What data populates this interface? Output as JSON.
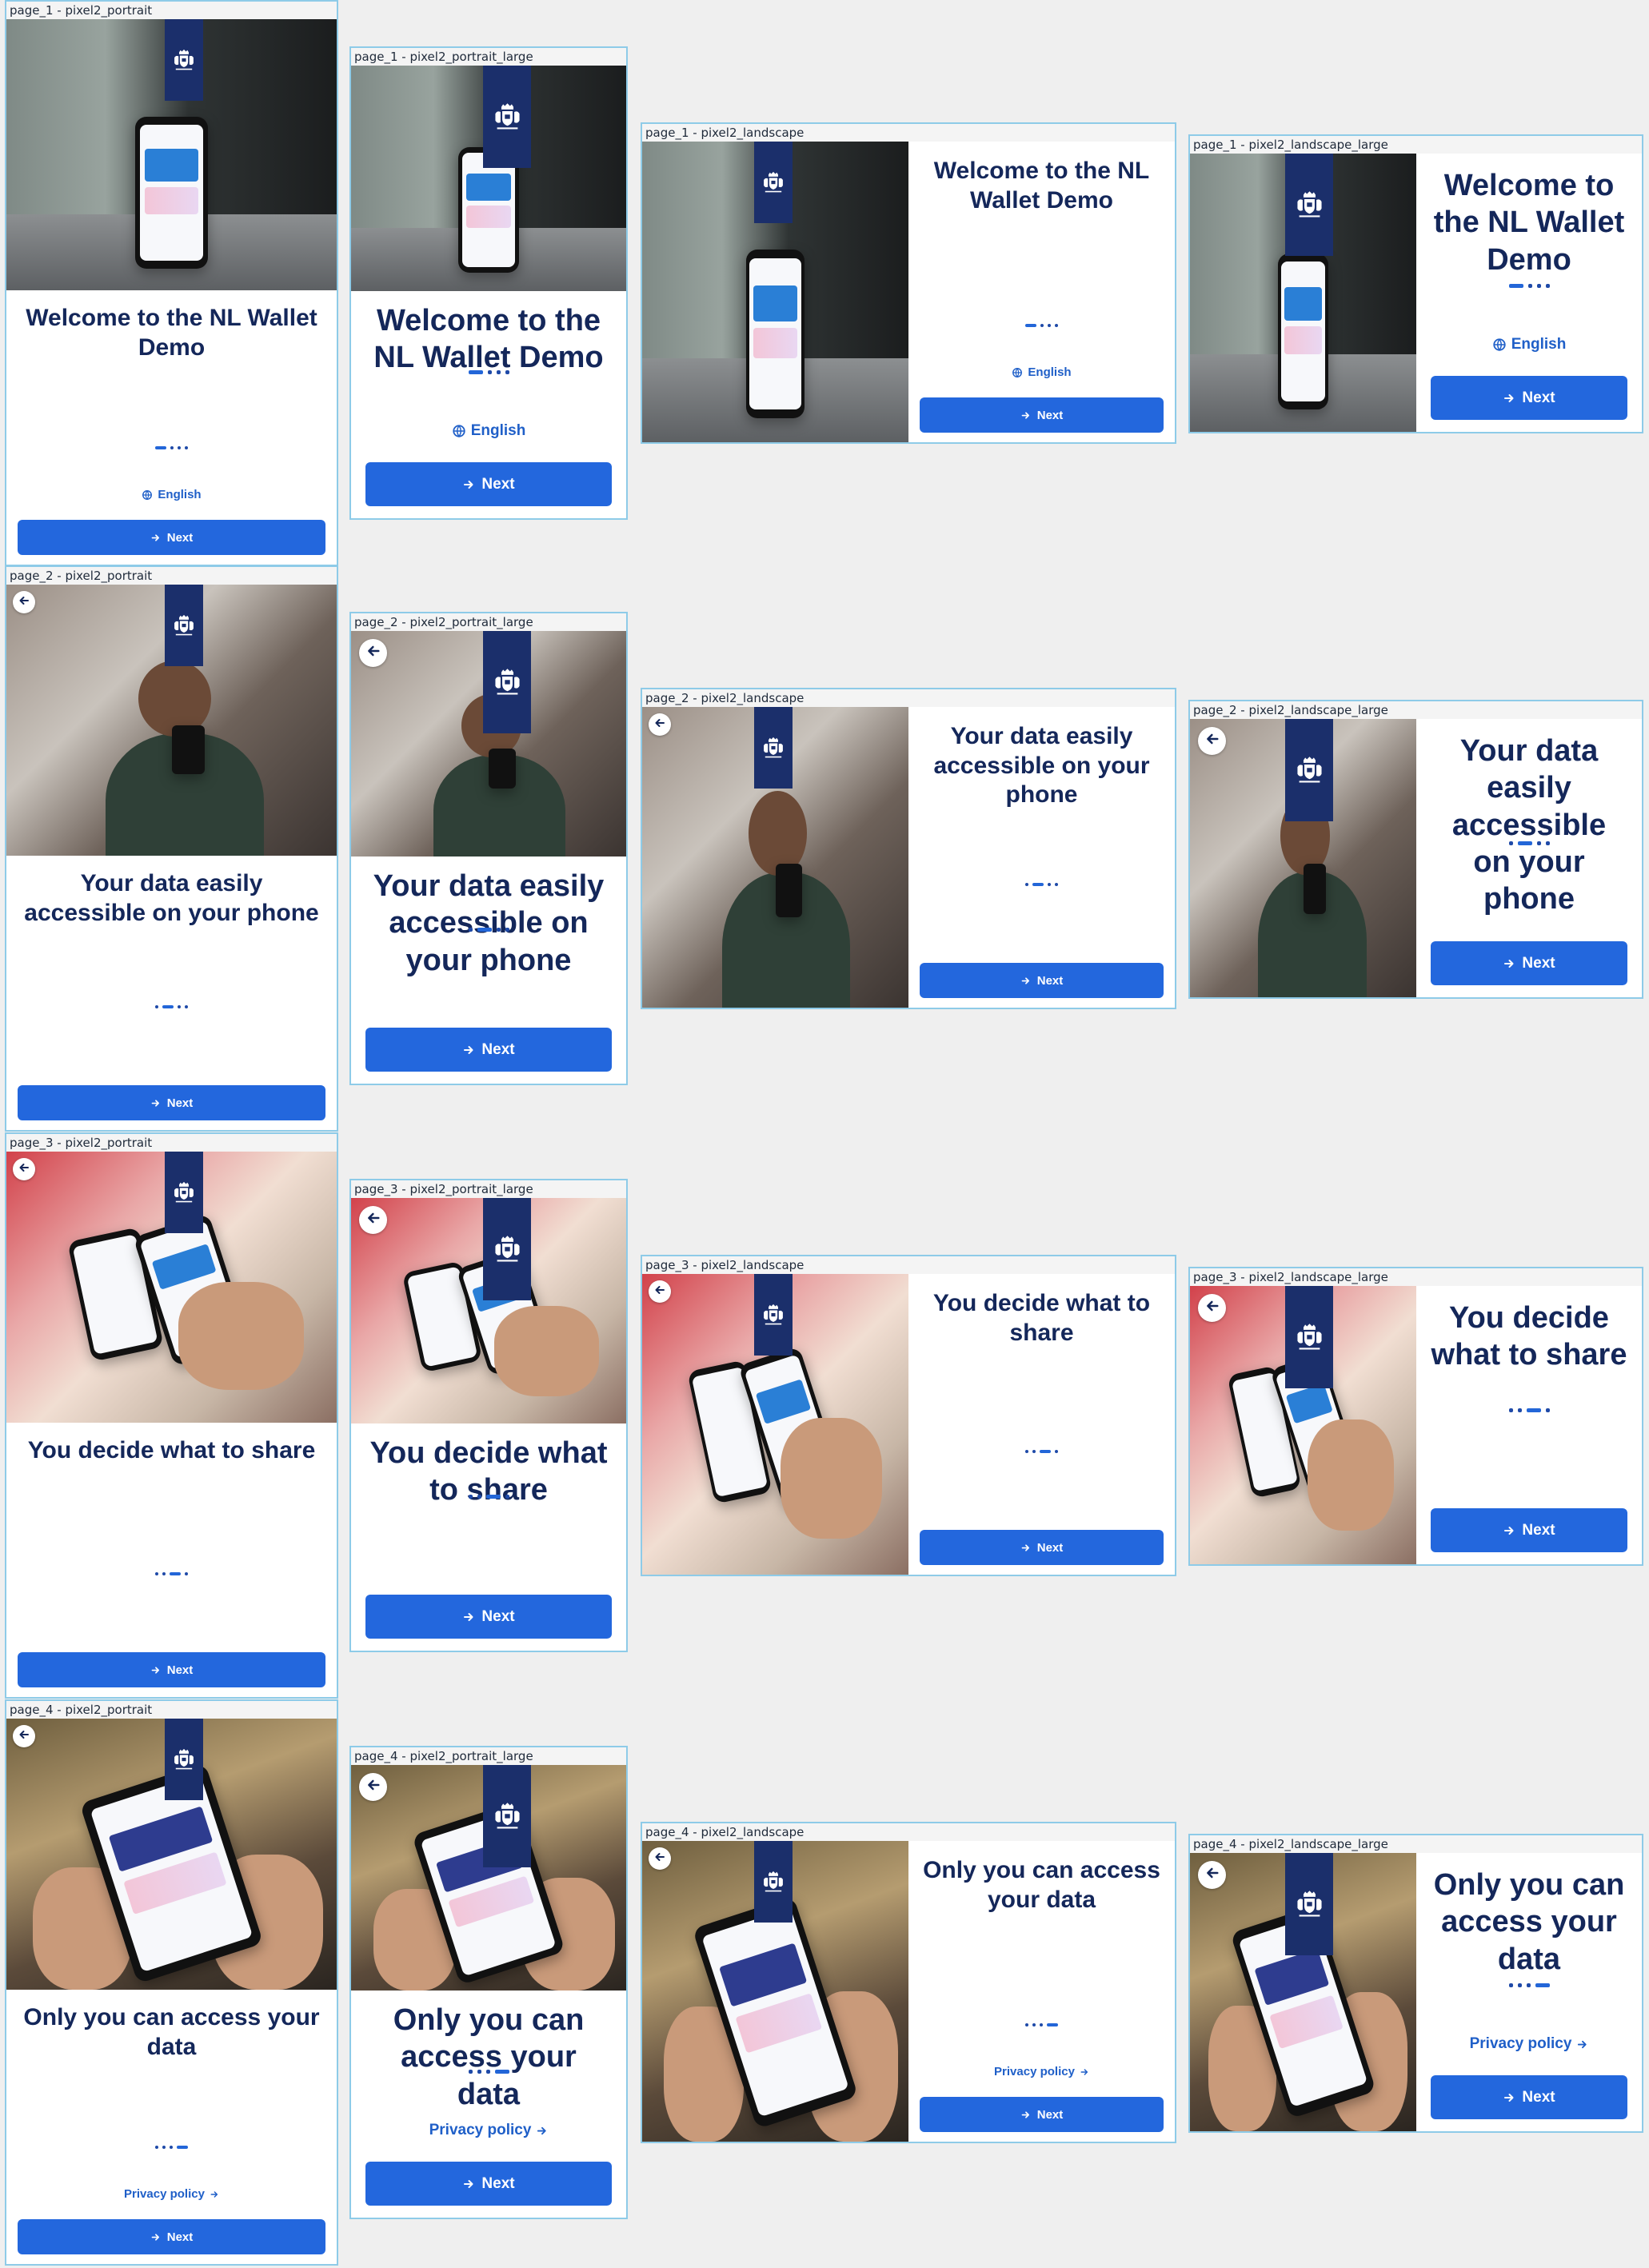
{
  "colors": {
    "accent": "#2367dd",
    "title": "#14275a",
    "banner": "#1b2f6b",
    "frame_border": "#8ecbe8",
    "canvas": "#efefef"
  },
  "pages": [
    {
      "title": "Welcome to the NL Wallet Demo",
      "active_dot": 0,
      "link_label": "English",
      "link_icon": "globe-icon",
      "next_label": "Next",
      "has_back": false,
      "frames": {
        "portrait": "page_1 - pixel2_portrait",
        "portrait_large": "page_1 - pixel2_portrait_large",
        "landscape": "page_1 - pixel2_landscape",
        "landscape_large": "page_1 - pixel2_landscape_large"
      }
    },
    {
      "title": "Your data easily accessible on your phone",
      "active_dot": 1,
      "link_label": "",
      "link_icon": "",
      "next_label": "Next",
      "has_back": true,
      "frames": {
        "portrait": "page_2 - pixel2_portrait",
        "portrait_large": "page_2 - pixel2_portrait_large",
        "landscape": "page_2 - pixel2_landscape",
        "landscape_large": "page_2 - pixel2_landscape_large"
      }
    },
    {
      "title": "You decide what to share",
      "active_dot": 2,
      "link_label": "",
      "link_icon": "",
      "next_label": "Next",
      "has_back": true,
      "frames": {
        "portrait": "page_3 - pixel2_portrait",
        "portrait_large": "page_3 - pixel2_portrait_large",
        "landscape": "page_3 - pixel2_landscape",
        "landscape_large": "page_3 - pixel2_landscape_large"
      }
    },
    {
      "title": "Only you can access your data",
      "active_dot": 3,
      "link_label": "Privacy policy",
      "link_icon": "arrow-right-icon",
      "next_label": "Next",
      "has_back": true,
      "frames": {
        "portrait": "page_4 - pixel2_portrait",
        "portrait_large": "page_4 - pixel2_portrait_large",
        "landscape": "page_4 - pixel2_landscape",
        "landscape_large": "page_4 - pixel2_landscape_large"
      }
    }
  ],
  "dot_count": 4
}
